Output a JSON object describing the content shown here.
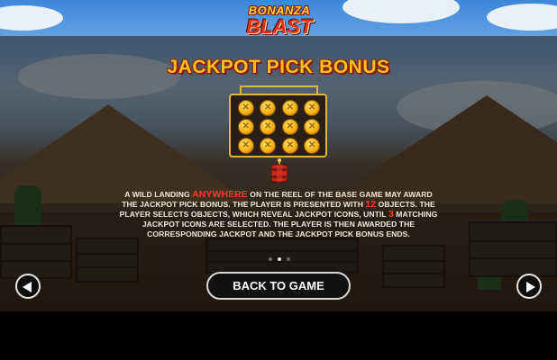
{
  "game": {
    "logo_line1": "BONANZA",
    "logo_line2": "BLAST"
  },
  "paytable": {
    "title": "JACKPOT PICK BONUS",
    "board": {
      "object_count": 12,
      "coin_icon": "gold-coin-icon"
    },
    "feature_icon": "dynamite-icon",
    "description": {
      "part1": "A WILD LANDING ",
      "highlight_anywhere": "ANYWHERE",
      "part2": " ON THE REEL OF THE BASE GAME MAY AWARD THE JACKPOT PICK BONUS. THE PLAYER IS PRESENTED WITH ",
      "highlight_objects": "12",
      "part3": " OBJECTS. THE PLAYER SELECTS OBJECTS, WHICH REVEAL JACKPOT ICONS, UNTIL ",
      "highlight_matching": "3",
      "part4": " MATCHING JACKPOT ICONS ARE SELECTED. THE PLAYER IS THEN AWARDED THE CORRESPONDING JACKPOT AND THE JACKPOT PICK BONUS ENDS."
    },
    "pagination": {
      "total": 3,
      "current": 2
    }
  },
  "controls": {
    "back_label": "BACK TO GAME",
    "prev_icon": "chevron-left-icon",
    "next_icon": "chevron-right-icon"
  },
  "colors": {
    "title": "#ffc21a",
    "highlight": "#ff3b2b",
    "board_frame": "#e2b43c"
  }
}
